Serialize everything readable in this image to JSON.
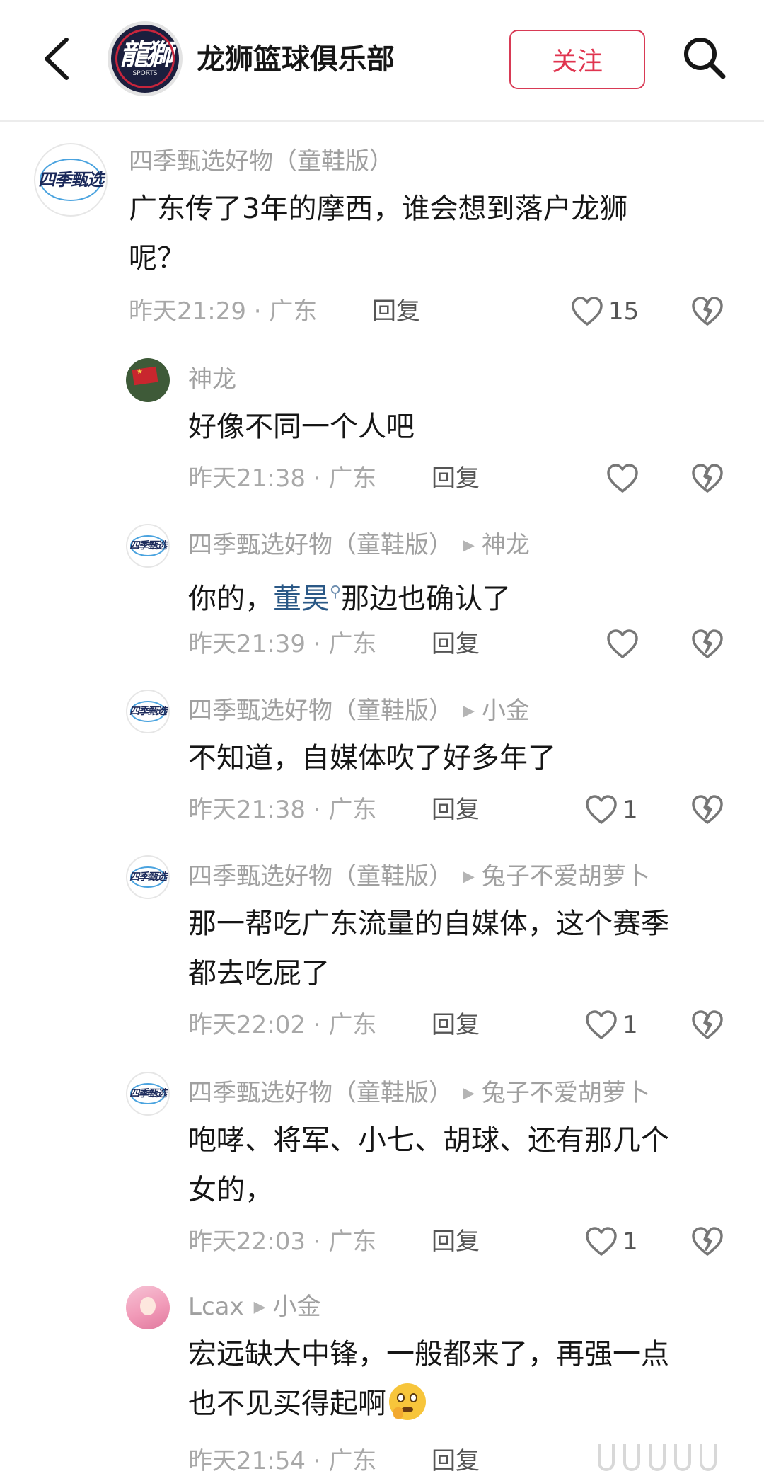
{
  "header": {
    "back_icon": "chevron-left-icon",
    "logo_text": "龍獅",
    "logo_subtext": "SPORTS",
    "club_name": "龙狮篮球俱乐部",
    "follow_label": "关注",
    "search_icon": "search-icon",
    "accent_color": "#e0344f"
  },
  "comments": [
    {
      "author": "四季甄选好物（童鞋版）",
      "lines": [
        "广东传了3年的摩西，谁会想到落户龙狮",
        "呢？"
      ],
      "time": "昨天21:29",
      "location": "广东",
      "reply_label": "回复",
      "likes": "15"
    }
  ],
  "replies": [
    {
      "author": "神龙",
      "reply_to": "",
      "lines": [
        "好像不同一个人吧"
      ],
      "time": "昨天21:38",
      "location": "广东",
      "reply_label": "回复",
      "likes": ""
    },
    {
      "author": "四季甄选好物（童鞋版）",
      "reply_to": "神龙",
      "text_before": "你的，",
      "mention": "董昊",
      "text_after": "那边也确认了",
      "time": "昨天21:39",
      "location": "广东",
      "reply_label": "回复",
      "likes": ""
    },
    {
      "author": "四季甄选好物（童鞋版）",
      "reply_to": "小金",
      "lines": [
        "不知道，自媒体吹了好多年了"
      ],
      "time": "昨天21:38",
      "location": "广东",
      "reply_label": "回复",
      "likes": "1"
    },
    {
      "author": "四季甄选好物（童鞋版）",
      "reply_to": "兔子不爱胡萝卜",
      "lines": [
        "那一帮吃广东流量的自媒体，这个赛季",
        "都去吃屁了"
      ],
      "time": "昨天22:02",
      "location": "广东",
      "reply_label": "回复",
      "likes": "1"
    },
    {
      "author": "四季甄选好物（童鞋版）",
      "reply_to": "兔子不爱胡萝卜",
      "lines": [
        "咆哮、将军、小七、胡球、还有那几个",
        "女的，"
      ],
      "time": "昨天22:03",
      "location": "广东",
      "reply_label": "回复",
      "likes": "1"
    },
    {
      "author": "Lcax",
      "reply_to": "小金",
      "lines": [
        "宏远缺大中锋，一般都来了，再强一点",
        "也不见买得起啊"
      ],
      "emoji": "thinking-face-emoji",
      "time": "昨天21:54",
      "location": "广东",
      "reply_label": "回复",
      "likes": ""
    }
  ],
  "brand_avatar_text": "四季甄选",
  "separator": "·"
}
